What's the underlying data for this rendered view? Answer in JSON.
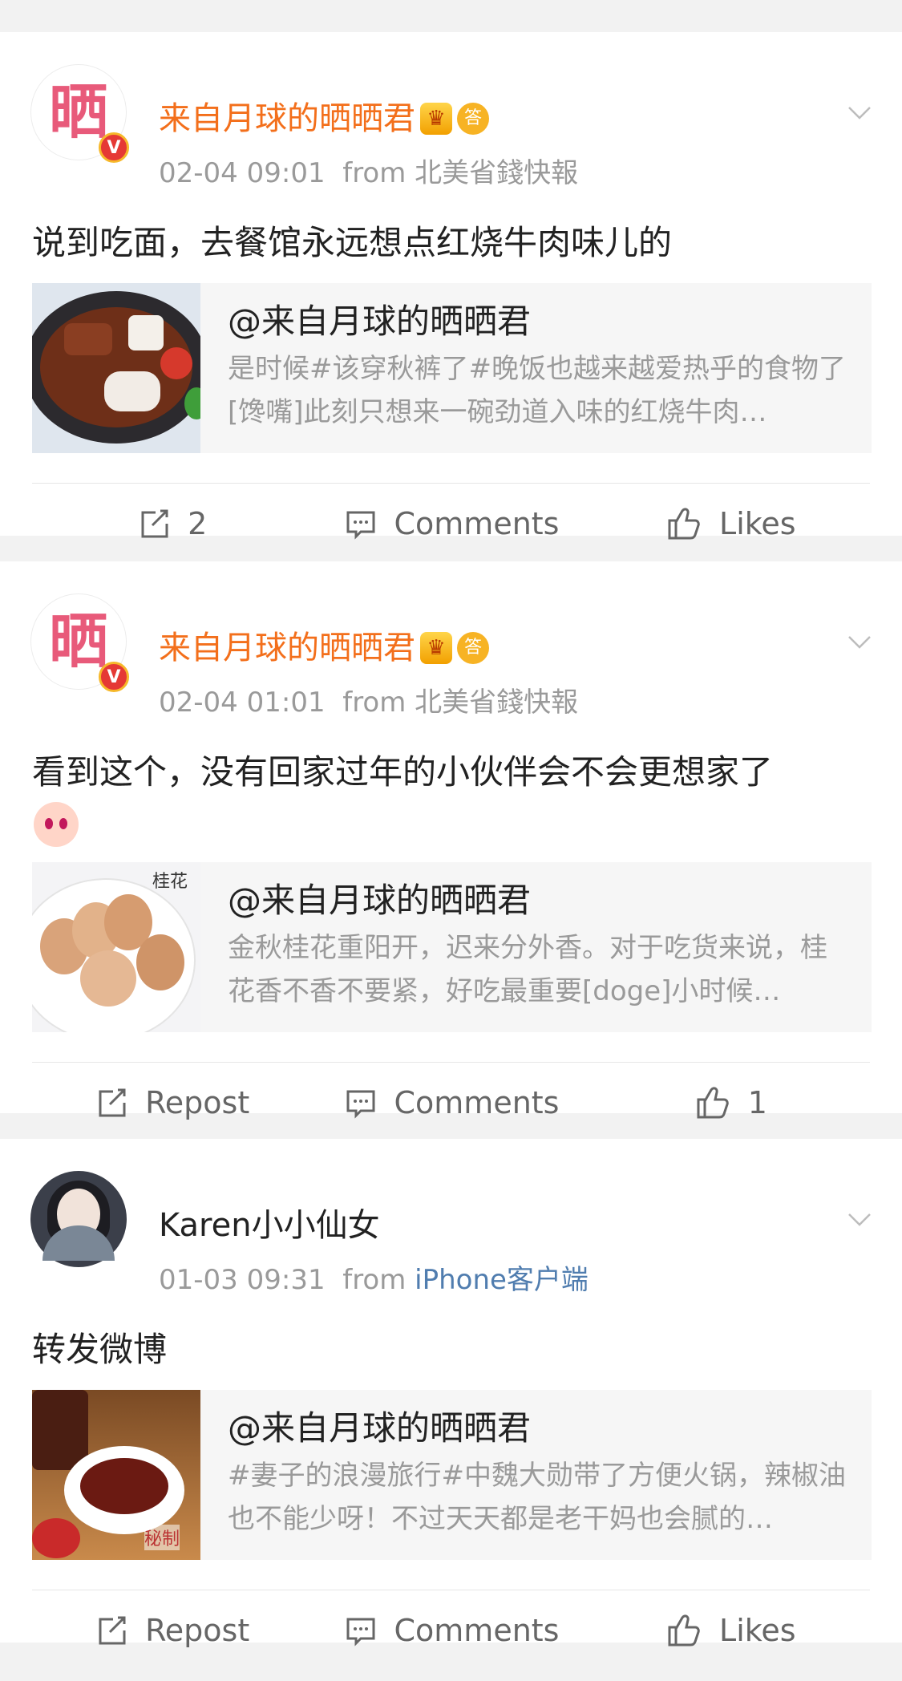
{
  "posts": [
    {
      "user": {
        "name": "来自月球的晒晒君",
        "avatar_char": "晒",
        "verified_badge": "V",
        "badges": [
          "crown-icon",
          "answer-icon"
        ],
        "answer_badge_char": "答"
      },
      "time": "02-04 09:01",
      "from_label": "from",
      "source": "北美省錢快報",
      "text": "说到吃面，去餐馆永远想点红烧牛肉味儿的",
      "quote": {
        "title": "@来自月球的晒晒君",
        "body": "是时候#该穿秋裤了#晚饭也越来越爱热乎的食物了[馋嘴]此刻只想来一碗劲道入味的红烧牛肉…"
      },
      "actions": {
        "repost": "2",
        "comments": "Comments",
        "likes": "Likes"
      }
    },
    {
      "user": {
        "name": "来自月球的晒晒君",
        "avatar_char": "晒",
        "verified_badge": "V",
        "badges": [
          "crown-icon",
          "answer-icon"
        ],
        "answer_badge_char": "答"
      },
      "time": "02-04 01:01",
      "from_label": "from",
      "source": "北美省錢快報",
      "text": "看到这个，没有回家过年的小伙伴会不会更想家了",
      "emoji": "tearful-emoji-icon",
      "quote": {
        "title": "@来自月球的晒晒君",
        "body": "金秋桂花重阳开，迟来分外香。对于吃货来说，桂花香不香不要紧，好吃最重要[doge]小时候…",
        "thumb_label": "桂花"
      },
      "actions": {
        "repost": "Repost",
        "comments": "Comments",
        "likes": "1"
      }
    },
    {
      "user": {
        "name": "Karen小小仙女"
      },
      "time": "01-03 09:31",
      "from_label": "from",
      "source": "iPhone客户端",
      "text": "转发微博",
      "quote": {
        "title": "@来自月球的晒晒君",
        "body": "#妻子的浪漫旅行#中魏大勋带了方便火锅，辣椒油也不能少呀！不过天天都是老干妈也会腻的…",
        "thumb_label": "秘制"
      },
      "actions": {
        "repost": "Repost",
        "comments": "Comments",
        "likes": "Likes"
      }
    }
  ],
  "colors": {
    "username": "#f36f1b",
    "source_link": "#507daf",
    "meta": "#9a9a9a",
    "badge_red": "#e53935"
  }
}
